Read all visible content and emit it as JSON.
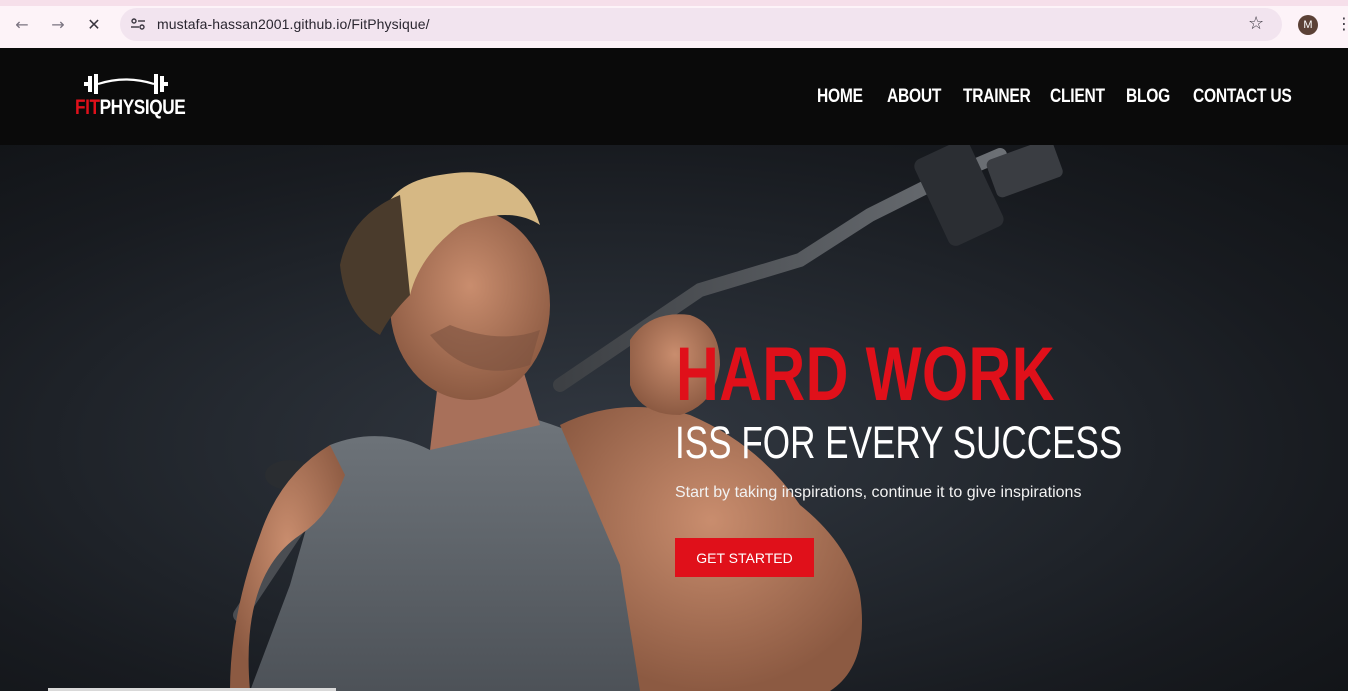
{
  "browser": {
    "url": "mustafa-hassan2001.github.io/FitPhysique/",
    "profile_initial": "M",
    "icons": [
      "back-icon",
      "forward-icon",
      "stop-loading-icon",
      "site-info-icon",
      "bookmark-star-icon",
      "kebab-menu-icon"
    ]
  },
  "site": {
    "logo": {
      "part1": "FIT",
      "part2": "PHYSIQUE"
    },
    "nav": [
      "HOME",
      "ABOUT",
      "TRAINER",
      "CLIENT",
      "BLOG",
      "CONTACT US"
    ],
    "colors": {
      "accent": "#e0101a",
      "header_bg": "#0a0a0a",
      "text": "#ffffff"
    }
  },
  "hero": {
    "headline": "HARD WORK",
    "subheadline": "ISS FOR EVERY SUCCESS",
    "tagline": "Start by taking inspirations, continue it to give inspirations",
    "cta_label": "GET STARTED"
  }
}
